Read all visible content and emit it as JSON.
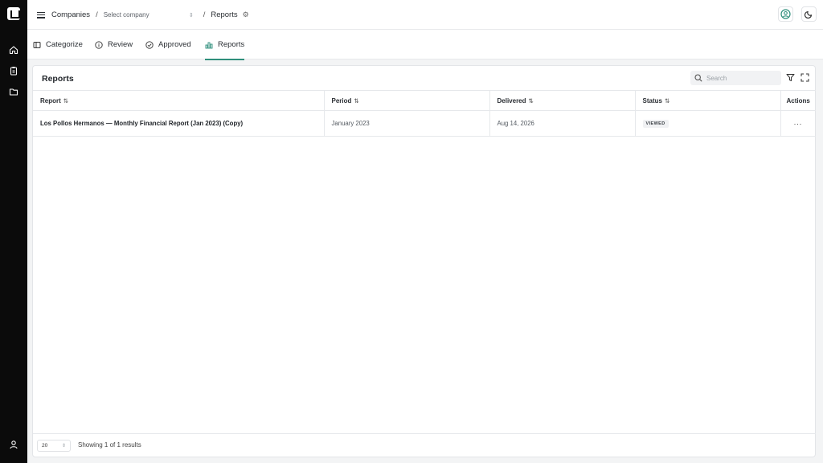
{
  "breadcrumb": {
    "companies": "Companies",
    "separator": "/",
    "company_placeholder": "Select company",
    "reports": "Reports"
  },
  "tabs": [
    {
      "label": "Categorize",
      "icon": "categorize-icon"
    },
    {
      "label": "Review",
      "icon": "info-icon"
    },
    {
      "label": "Approved",
      "icon": "check-circle-icon"
    },
    {
      "label": "Reports",
      "icon": "bar-chart-icon",
      "active": true
    }
  ],
  "panel": {
    "title": "Reports",
    "search_placeholder": "Search"
  },
  "table": {
    "columns": [
      "Report",
      "Period",
      "Delivered",
      "Status",
      "Actions"
    ],
    "rows": [
      {
        "report": "Los Pollos Hermanos — Monthly Financial Report (Jan 2023) (Copy)",
        "period": "January 2023",
        "delivered": "Aug 14, 2026",
        "status": "VIEWED",
        "actions": "···"
      }
    ]
  },
  "footer": {
    "page_size": "20",
    "result_text": "Showing 1 of 1 results"
  },
  "colors": {
    "sidebar": "#0b0b0b",
    "accent": "#2f8f7c"
  }
}
